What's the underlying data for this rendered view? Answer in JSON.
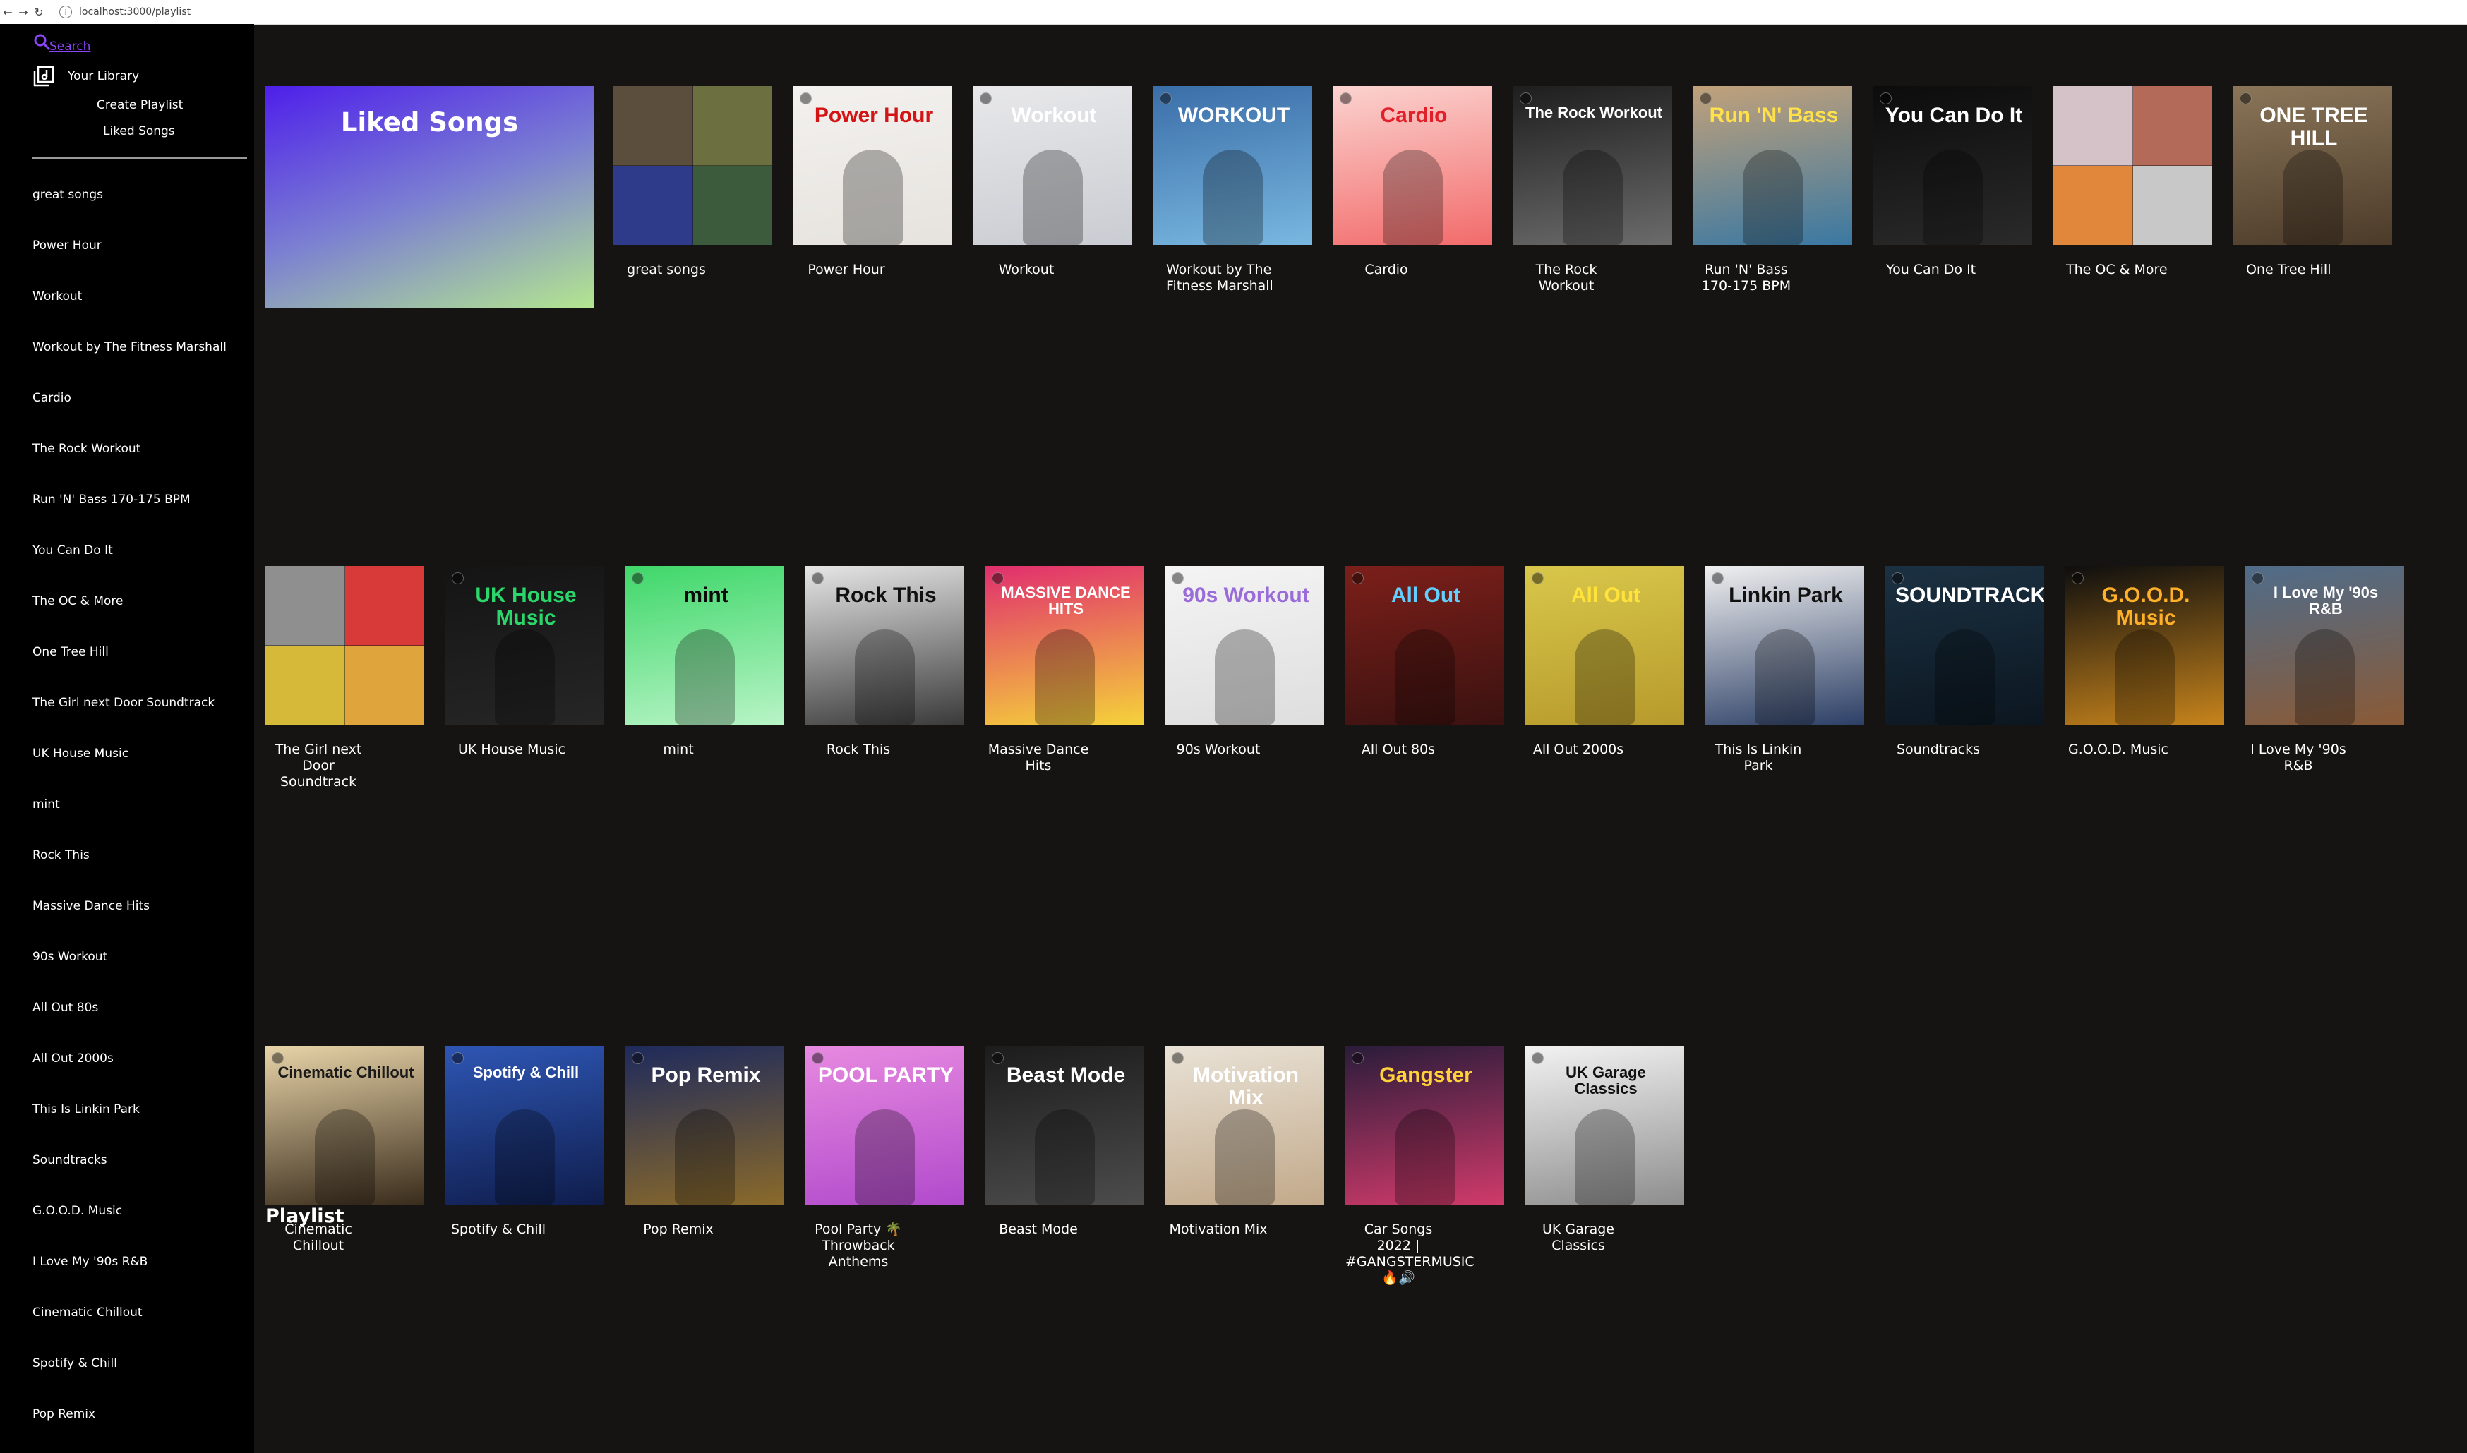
{
  "browser": {
    "url": "localhost:3000/playlist"
  },
  "sidebar": {
    "search_label": "Search",
    "library_label": "Your Library",
    "create_playlist_label": "Create Playlist",
    "liked_songs_label": "Liked Songs",
    "items": [
      "great songs",
      "Power Hour",
      "Workout",
      "Workout by The Fitness Marshall",
      "Cardio",
      "The Rock Workout",
      "Run 'N' Bass 170-175 BPM",
      "You Can Do It",
      "The OC & More",
      "One Tree Hill",
      "The Girl next Door Soundtrack",
      "UK House Music",
      "mint",
      "Rock This",
      "Massive Dance Hits",
      "90s Workout",
      "All Out 80s",
      "All Out 2000s",
      "This Is Linkin Park",
      "Soundtracks",
      "G.O.O.D. Music",
      "I Love My '90s R&B",
      "Cinematic Chillout",
      "Spotify & Chill",
      "Pop Remix"
    ]
  },
  "main": {
    "liked_card_title": "Liked Songs",
    "section_heading": "Playlist",
    "icons": [
      "search-icon",
      "library-icon",
      "spotify-badge-icon"
    ],
    "playlists": [
      {
        "name": "great songs",
        "cover": [
          "#5b4e3c",
          "#6c7040",
          "#2e3a8a",
          "#3c5a3c"
        ],
        "text": ""
      },
      {
        "name": "Power Hour",
        "cover": [
          "#f3f1ee",
          "#e6e3de"
        ],
        "text": "Power Hour",
        "tc": "#d21414"
      },
      {
        "name": "Workout",
        "cover": [
          "#e8e8ea",
          "#c9ccd2"
        ],
        "text": "Workout",
        "tc": "#ffffff"
      },
      {
        "name": "Workout by The Fitness Marshall",
        "cover": [
          "#3a6ea8",
          "#79b7e0"
        ],
        "text": "WORKOUT",
        "tc": "#ffffff"
      },
      {
        "name": "Cardio",
        "cover": [
          "#fbd3cf",
          "#f26b6b"
        ],
        "text": "Cardio",
        "tc": "#e0202a"
      },
      {
        "name": "The Rock Workout",
        "cover": [
          "#1e1e1e",
          "#6b6b6b"
        ],
        "text": "The Rock Workout",
        "tc": "#ffffff"
      },
      {
        "name": "Run 'N' Bass 170-175 BPM",
        "cover": [
          "#c2a17a",
          "#3a78a2"
        ],
        "text": "Run 'N' Bass",
        "tc": "#ffe14a"
      },
      {
        "name": "You Can Do It",
        "cover": [
          "#0c0c0c",
          "#2a2a2a"
        ],
        "text": "You Can Do It",
        "tc": "#ffffff"
      },
      {
        "name": "The OC & More",
        "cover": [
          "#d5c2c9",
          "#b46a58",
          "#e0873c",
          "#c8c8c8"
        ],
        "text": "",
        "tc": "#ffffff"
      },
      {
        "name": "One Tree Hill",
        "cover": [
          "#8a7558",
          "#4c3b2a"
        ],
        "text": "ONE TREE HILL",
        "tc": "#ffffff"
      },
      {
        "name": "The Girl next Door Soundtrack",
        "cover": [
          "#8f8f8f",
          "#d83a3a",
          "#d7b93a",
          "#e0a43c"
        ],
        "text": "",
        "tc": "#ffffff"
      },
      {
        "name": "UK House Music",
        "cover": [
          "#141414",
          "#262626"
        ],
        "text": "UK House Music",
        "tc": "#2bd66a"
      },
      {
        "name": "mint",
        "cover": [
          "#3fd76a",
          "#b8f4c6"
        ],
        "text": "mint",
        "tc": "#0b0b0b"
      },
      {
        "name": "Rock This",
        "cover": [
          "#e6e6e6",
          "#3a3a3a"
        ],
        "text": "Rock This",
        "tc": "#111111"
      },
      {
        "name": "Massive Dance Hits",
        "cover": [
          "#e12e6e",
          "#f5d23a"
        ],
        "text": "MASSIVE DANCE HITS",
        "tc": "#ffffff"
      },
      {
        "name": "90s Workout",
        "cover": [
          "#f4f4f4",
          "#dedede"
        ],
        "text": "90s Workout",
        "tc": "#9a6cd8"
      },
      {
        "name": "All Out 80s",
        "cover": [
          "#7c1f1a",
          "#3a1210"
        ],
        "text": "All Out",
        "tc": "#5fd0ff"
      },
      {
        "name": "All Out 2000s",
        "cover": [
          "#d8c74a",
          "#b79a2c"
        ],
        "text": "All Out",
        "tc": "#ffe23a"
      },
      {
        "name": "This Is Linkin Park",
        "cover": [
          "#f0f0f0",
          "#2c3f66"
        ],
        "text": "Linkin Park",
        "tc": "#111111"
      },
      {
        "name": "Soundtracks",
        "cover": [
          "#1b3142",
          "#0c1620"
        ],
        "text": "SOUNDTRACKS",
        "tc": "#ffffff"
      },
      {
        "name": "G.O.O.D. Music",
        "cover": [
          "#0e0e0e",
          "#c7841c"
        ],
        "text": "G.O.O.D. Music",
        "tc": "#ffb02a"
      },
      {
        "name": "I Love My '90s R&B",
        "cover": [
          "#4f6c8a",
          "#8a5a36"
        ],
        "text": "I Love My '90s R&B",
        "tc": "#ffffff"
      },
      {
        "name": "Cinematic Chillout",
        "cover": [
          "#e8d4a8",
          "#3a2c1c"
        ],
        "text": "Cinematic Chillout",
        "tc": "#1a1a1a"
      },
      {
        "name": "Spotify & Chill",
        "cover": [
          "#2e56b4",
          "#0f1d4c"
        ],
        "text": "Spotify & Chill",
        "tc": "#ffffff"
      },
      {
        "name": "Pop Remix",
        "cover": [
          "#1e2a5c",
          "#8a6a2a"
        ],
        "text": "Pop Remix",
        "tc": "#ffffff"
      },
      {
        "name": "Pool Party 🌴 Throwback Anthems",
        "cover": [
          "#e78ae0",
          "#b24acc"
        ],
        "text": "POOL PARTY",
        "tc": "#ffffff"
      },
      {
        "name": "Beast Mode",
        "cover": [
          "#1c1c1c",
          "#4c4c4c"
        ],
        "text": "Beast Mode",
        "tc": "#ffffff"
      },
      {
        "name": "Motivation Mix",
        "cover": [
          "#e9e2d6",
          "#c2a98a"
        ],
        "text": "Motivation Mix",
        "tc": "#ffffff"
      },
      {
        "name": "Car Songs 2022 | #GANGSTERMUSIC 🔥🔊",
        "cover": [
          "#2a1c3a",
          "#d03a6a"
        ],
        "text": "Gangster",
        "tc": "#ffd23a"
      },
      {
        "name": "UK Garage Classics",
        "cover": [
          "#f2f2f2",
          "#8e8e8e"
        ],
        "text": "UK Garage Classics",
        "tc": "#111111"
      }
    ]
  }
}
